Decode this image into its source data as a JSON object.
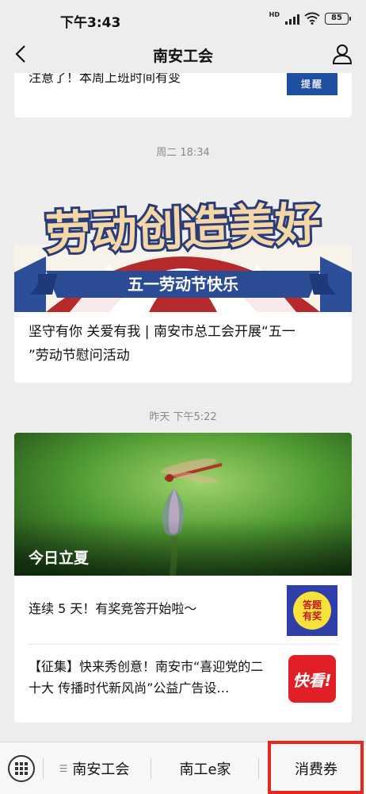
{
  "status_bar": {
    "time": "下午3:43",
    "network_tag": "HD",
    "battery": "85"
  },
  "nav": {
    "title": "南安工会"
  },
  "articles": {
    "top": {
      "title": "注意了！本周上班时间有变",
      "thumb_text": "提醒"
    },
    "labor": {
      "timestamp": "周二 18:34",
      "banner_line1": "劳动创造美好",
      "banner_line2": "五一劳动节快乐",
      "title_line1": "坚守有你 关爱有我 | 南安市总工会开展“五一",
      "title_line2": "”劳动节慰问活动"
    },
    "summer": {
      "timestamp": "昨天 下午5:22",
      "caption": "今日立夏",
      "sub1": {
        "title": "连续 5 天！有奖竞答开始啦～",
        "thumb_line1": "答题",
        "thumb_line2": "有奖"
      },
      "sub2": {
        "title_line1": "【征集】快来秀创意！南安市“喜迎党的二",
        "title_line2": "十大 传播时代新风尚”公益广告设…",
        "thumb_text": "快看!"
      }
    }
  },
  "bottom_menu": {
    "item1": "南安工会",
    "item2": "南工e家",
    "item3": "消费券"
  },
  "colors": {
    "highlight": "#e8281c",
    "background": "#ededed"
  }
}
